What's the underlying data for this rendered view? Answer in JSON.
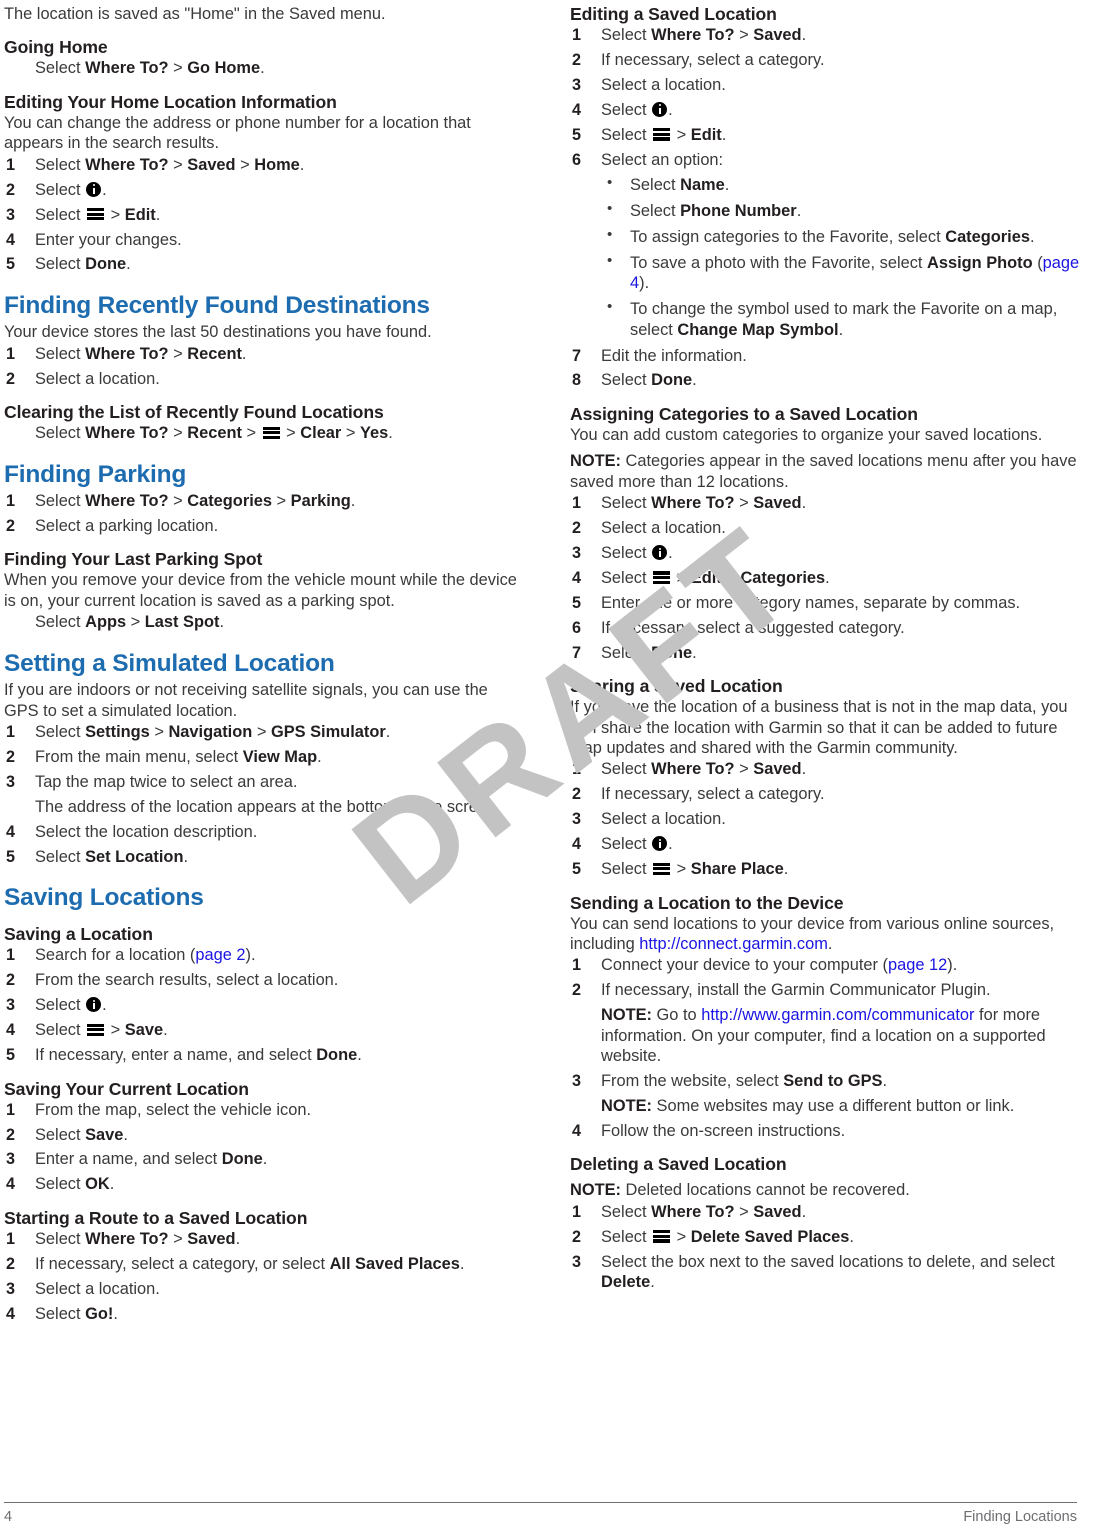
{
  "document": {
    "watermark": "DRAFT",
    "footer": {
      "page_number": "4",
      "running_head": "Finding Locations"
    },
    "colors": {
      "heading_blue": "#1d6cb0",
      "link_blue": "#1a14e2",
      "body_gray": "#3a3a3c",
      "watermark_gray": "#c3c3c3"
    }
  },
  "left_column": {
    "intro": "The location is saved as \"Home\" in the Saved menu.",
    "going_home": {
      "heading": "Going Home",
      "step": {
        "pre": "Select ",
        "a": "Where To?",
        "sep": " > ",
        "b": "Go Home",
        "end": "."
      }
    },
    "editing_home": {
      "heading": "Editing Your Home Location Information",
      "intro": "You can change the address or phone number for a location that appears in the search results.",
      "steps": [
        {
          "pre": "Select ",
          "a": "Where To?",
          "s1": " > ",
          "b": "Saved",
          "s2": " > ",
          "c": "Home",
          "end": "."
        },
        {
          "pre": "Select ",
          "icon": "info-icon",
          "end": "."
        },
        {
          "pre": "Select ",
          "icon": "menu-icon",
          "s1": " > ",
          "a": "Edit",
          "end": "."
        },
        {
          "text": "Enter your changes."
        },
        {
          "pre": "Select ",
          "a": "Done",
          "end": "."
        }
      ]
    },
    "recently_found": {
      "heading": "Finding Recently Found Destinations",
      "intro": "Your device stores the last 50 destinations you have found.",
      "steps": [
        {
          "pre": "Select ",
          "a": "Where To?",
          "s1": " > ",
          "b": "Recent",
          "end": "."
        },
        {
          "text": "Select a location."
        }
      ]
    },
    "clearing_recent": {
      "heading": "Clearing the List of Recently Found Locations",
      "step": {
        "pre": "Select ",
        "a": "Where To?",
        "s1": " > ",
        "b": "Recent",
        "s2": " > ",
        "icon": "menu-icon",
        "s3": " > ",
        "c": "Clear",
        "s4": " > ",
        "d": "Yes",
        "end": "."
      }
    },
    "finding_parking": {
      "heading": "Finding Parking",
      "steps": [
        {
          "pre": "Select ",
          "a": "Where To?",
          "s1": " > ",
          "b": "Categories",
          "s2": " > ",
          "c": "Parking",
          "end": "."
        },
        {
          "text": "Select a parking location."
        }
      ]
    },
    "last_parking_spot": {
      "heading": "Finding Your Last Parking Spot",
      "intro": "When you remove your device from the vehicle mount while the device is on, your current location is saved as a parking spot.",
      "step": {
        "pre": "Select ",
        "a": "Apps",
        "s1": " > ",
        "b": "Last Spot",
        "end": "."
      }
    },
    "simulated_location": {
      "heading": "Setting a Simulated Location",
      "intro": "If you are indoors or not receiving satellite signals, you can use the GPS to set a simulated location.",
      "steps": [
        {
          "pre": "Select ",
          "a": "Settings",
          "s1": " > ",
          "b": "Navigation",
          "s2": " > ",
          "c": "GPS Simulator",
          "end": "."
        },
        {
          "pre": "From the main menu, select ",
          "a": "View Map",
          "end": "."
        },
        {
          "text": "Tap the map twice to select an area.",
          "cont": "The address of the location appears at the bottom of the screen."
        },
        {
          "text": "Select the location description."
        },
        {
          "pre": "Select ",
          "a": "Set Location",
          "end": "."
        }
      ]
    },
    "saving_locations": {
      "heading": "Saving Locations",
      "saving_a_location": {
        "heading": "Saving a Location",
        "steps": [
          {
            "pre": "Search for a location (",
            "xref": "page 2",
            "end": ")."
          },
          {
            "text": "From the search results, select a location."
          },
          {
            "pre": "Select ",
            "icon": "info-icon",
            "end": "."
          },
          {
            "pre": "Select ",
            "icon": "menu-icon",
            "s1": " > ",
            "a": "Save",
            "end": "."
          },
          {
            "pre": "If necessary, enter a name, and select ",
            "a": "Done",
            "end": "."
          }
        ]
      },
      "saving_current_location": {
        "heading": "Saving Your Current Location",
        "steps": [
          {
            "text": "From the map, select the vehicle icon."
          },
          {
            "pre": "Select ",
            "a": "Save",
            "end": "."
          },
          {
            "pre": "Enter a name, and select ",
            "a": "Done",
            "end": "."
          },
          {
            "pre": "Select ",
            "a": "OK",
            "end": "."
          }
        ]
      },
      "starting_route": {
        "heading": "Starting a Route to a Saved Location",
        "steps": [
          {
            "pre": "Select ",
            "a": "Where To?",
            "s1": " > ",
            "b": "Saved",
            "end": "."
          },
          {
            "pre": "If necessary, select a category, or select ",
            "a": "All Saved Places",
            "end": "."
          },
          {
            "text": "Select a location."
          },
          {
            "pre": "Select ",
            "a": "Go!",
            "end": "."
          }
        ]
      }
    }
  },
  "right_column": {
    "editing_saved": {
      "heading": "Editing a Saved Location",
      "steps": [
        {
          "pre": "Select ",
          "a": "Where To?",
          "s1": " > ",
          "b": "Saved",
          "end": "."
        },
        {
          "text": "If necessary, select a category."
        },
        {
          "text": "Select a location."
        },
        {
          "pre": "Select ",
          "icon": "info-icon",
          "end": "."
        },
        {
          "pre": "Select ",
          "icon": "menu-icon",
          "s1": " > ",
          "a": "Edit",
          "end": "."
        },
        {
          "text": "Select an option:"
        },
        {
          "text": "Edit the information."
        },
        {
          "pre": "Select ",
          "a": "Done",
          "end": "."
        }
      ],
      "options": [
        {
          "pre": "Select ",
          "a": "Name",
          "end": "."
        },
        {
          "pre": "Select ",
          "a": "Phone Number",
          "end": "."
        },
        {
          "pre": "To assign categories to the Favorite, select ",
          "a": "Categories",
          "end": "."
        },
        {
          "pre": "To save a photo with the Favorite, select ",
          "a": "Assign Photo",
          "mid": " (",
          "xref": "page 4",
          "end": ")."
        },
        {
          "pre": "To change the symbol used to mark the Favorite on a map, select ",
          "a": "Change Map Symbol",
          "end": "."
        }
      ]
    },
    "assigning_categories": {
      "heading": "Assigning Categories to a Saved Location",
      "intro": "You can add custom categories to organize your saved locations.",
      "note_label": "NOTE:",
      "note": " Categories appear in the saved locations menu after you have saved more than 12 locations.",
      "steps": [
        {
          "pre": "Select ",
          "a": "Where To?",
          "s1": " > ",
          "b": "Saved",
          "end": "."
        },
        {
          "text": "Select a location."
        },
        {
          "pre": "Select ",
          "icon": "info-icon",
          "end": "."
        },
        {
          "pre": "Select ",
          "icon": "menu-icon",
          "s1": " > ",
          "a": "Edit",
          "s2": " > ",
          "b": "Categories",
          "end": "."
        },
        {
          "text": "Enter one or more category names, separate by commas."
        },
        {
          "text": "If necessary, select a suggested category."
        },
        {
          "pre": "Select ",
          "a": "Done",
          "end": "."
        }
      ]
    },
    "sharing_saved": {
      "heading": "Sharing a Saved Location",
      "intro": "If you save the location of a business that is not in the map data, you can share the location with Garmin so that it can be added to future map updates and shared with the Garmin community.",
      "steps": [
        {
          "pre": "Select ",
          "a": "Where To?",
          "s1": " > ",
          "b": "Saved",
          "end": "."
        },
        {
          "text": "If necessary, select a category."
        },
        {
          "text": "Select a location."
        },
        {
          "pre": "Select ",
          "icon": "info-icon",
          "end": "."
        },
        {
          "pre": "Select ",
          "icon": "menu-icon",
          "s1": " > ",
          "a": "Share Place",
          "end": "."
        }
      ]
    },
    "sending_location": {
      "heading": "Sending a Location to the Device",
      "intro_pre": "You can send locations to your device from various online sources, including ",
      "intro_url": "http://connect.garmin.com",
      "intro_end": ".",
      "steps": [
        {
          "pre": "Connect your device to your computer (",
          "xref": "page 12",
          "end": ")."
        },
        {
          "text": "If necessary, install the Garmin Communicator Plugin.",
          "note_label": "NOTE:",
          "note_pre": " Go to ",
          "note_url": "http://www.garmin.com/communicator",
          "note_end": " for more information. On your computer, find a location on a supported website."
        },
        {
          "pre": "From the website, select ",
          "a": "Send to GPS",
          "end": ".",
          "note_label": "NOTE:",
          "note_end": " Some websites may use a different button or link."
        },
        {
          "text": "Follow the on-screen instructions."
        }
      ]
    },
    "deleting_saved": {
      "heading": "Deleting a Saved Location",
      "note_label": "NOTE:",
      "note": " Deleted locations cannot be recovered.",
      "steps": [
        {
          "pre": "Select ",
          "a": "Where To?",
          "s1": " > ",
          "b": "Saved",
          "end": "."
        },
        {
          "pre": "Select ",
          "icon": "menu-icon",
          "s1": " > ",
          "a": "Delete Saved Places",
          "end": "."
        },
        {
          "pre": "Select the box next to the saved locations to delete, and select ",
          "a": "Delete",
          "end": "."
        }
      ]
    }
  }
}
